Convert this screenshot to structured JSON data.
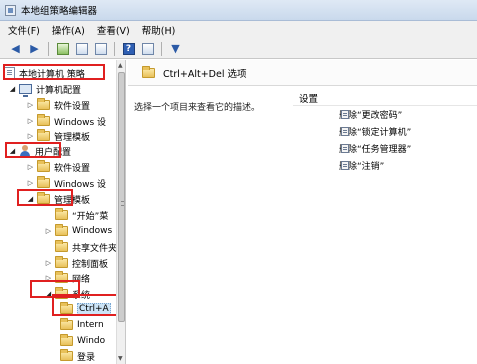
{
  "window": {
    "title": "本地组策略编辑器"
  },
  "menu": [
    "文件(F)",
    "操作(A)",
    "查看(V)",
    "帮助(H)"
  ],
  "toolbar": {
    "icons": [
      "back-arrow-icon",
      "forward-arrow-icon",
      "up-folder-icon",
      "show-hide-tree-icon",
      "export-list-icon",
      "help-icon",
      "properties-icon",
      "filter-icon"
    ],
    "help_label": "?"
  },
  "tree": {
    "items": [
      {
        "label": "本地计算机 策略"
      },
      {
        "label": "计算机配置"
      },
      {
        "label": "软件设置"
      },
      {
        "label": "Windows 设"
      },
      {
        "label": "管理模板"
      },
      {
        "label": "用户配置"
      },
      {
        "label": "软件设置"
      },
      {
        "label": "Windows 设"
      },
      {
        "label": "管理模板"
      },
      {
        "label": "“开始”菜"
      },
      {
        "label": "Windows"
      },
      {
        "label": "共享文件夹"
      },
      {
        "label": "控制面板"
      },
      {
        "label": "网络"
      },
      {
        "label": "系统"
      },
      {
        "label": "Ctrl+A"
      },
      {
        "label": "Intern"
      },
      {
        "label": "Windo"
      },
      {
        "label": "登录"
      }
    ]
  },
  "details": {
    "header": "Ctrl+Alt+Del 选项",
    "description": "选择一个项目来查看它的描述。",
    "column": "设置",
    "settings": [
      {
        "label": "删除“更改密码”"
      },
      {
        "label": "删除“锁定计算机”"
      },
      {
        "label": "删除“任务管理器”"
      },
      {
        "label": "删除“注销”"
      }
    ]
  },
  "colors": {
    "highlight_box": "#e02020",
    "selection": "#cce4f7"
  }
}
